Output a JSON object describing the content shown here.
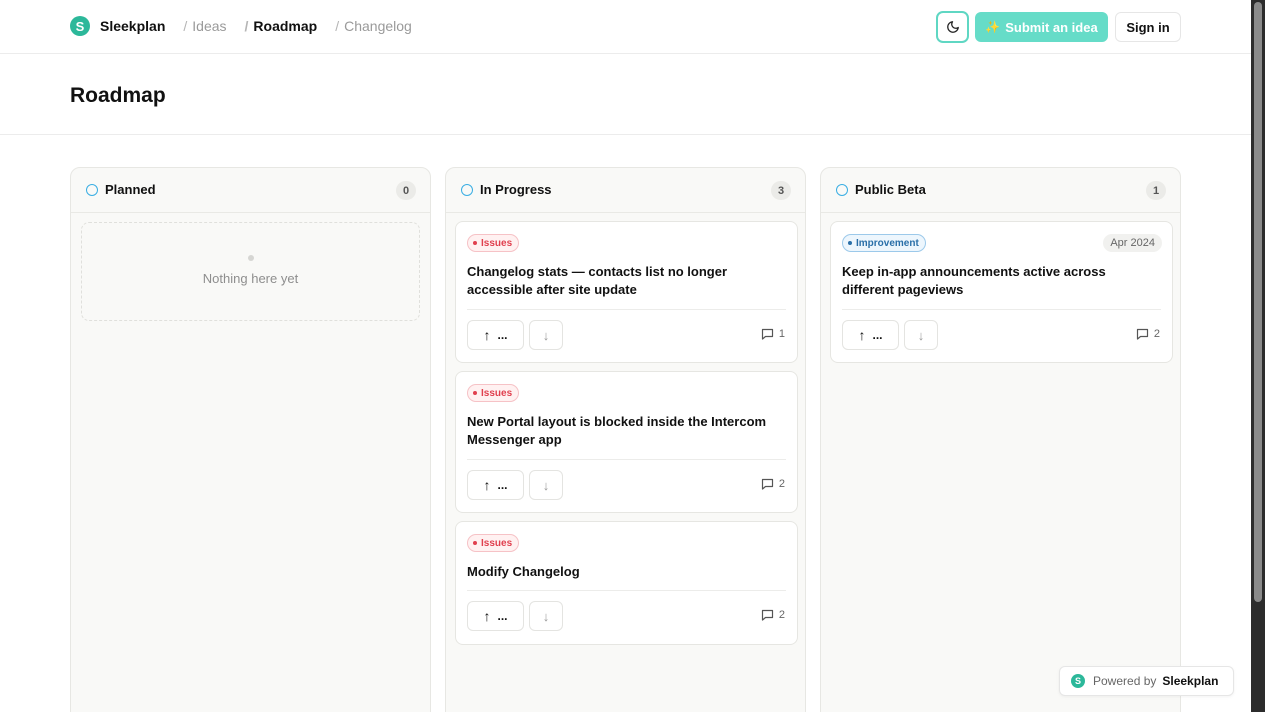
{
  "nav": {
    "logo_letter": "S",
    "brand": "Sleekplan",
    "crumbs": [
      {
        "sep": "/",
        "label": "Ideas"
      },
      {
        "sep": "/",
        "label": "Roadmap"
      },
      {
        "sep": "/",
        "label": "Changelog"
      }
    ],
    "theme_icon": "moon-icon",
    "submit_label": "Submit an idea",
    "submit_icon": "sparkles-icon",
    "signin_label": "Sign in"
  },
  "page": {
    "title": "Roadmap"
  },
  "columns": [
    {
      "title": "Planned",
      "count": "0",
      "empty_text": "Nothing here yet",
      "cards": []
    },
    {
      "title": "In Progress",
      "count": "3",
      "cards": [
        {
          "badge": "Issues",
          "title": "Changelog stats — contacts list no longer accessible after site update",
          "upvotes": "...",
          "comments": "1"
        },
        {
          "badge": "Issues",
          "title": "New Portal layout is blocked inside the Intercom Messenger app",
          "upvotes": "...",
          "comments": "2"
        },
        {
          "badge": "Issues",
          "title": "Modify Changelog",
          "upvotes": "...",
          "comments": "2"
        }
      ]
    },
    {
      "title": "Public Beta",
      "count": "1",
      "cards": [
        {
          "badge": "Improvement",
          "date": "Apr 2024",
          "title": "Keep in-app announcements active across different pageviews",
          "upvotes": "...",
          "comments": "2"
        }
      ]
    }
  ],
  "footer": {
    "logo_letter": "S",
    "powered_prefix": "Powered by",
    "powered_brand": "Sleekplan"
  },
  "colors": {
    "brand": "#2cb89a",
    "accent": "#66dcc8",
    "issues": "#e03f4e",
    "improvement": "#2a6fa8",
    "status_ring": "#3aaee3"
  }
}
